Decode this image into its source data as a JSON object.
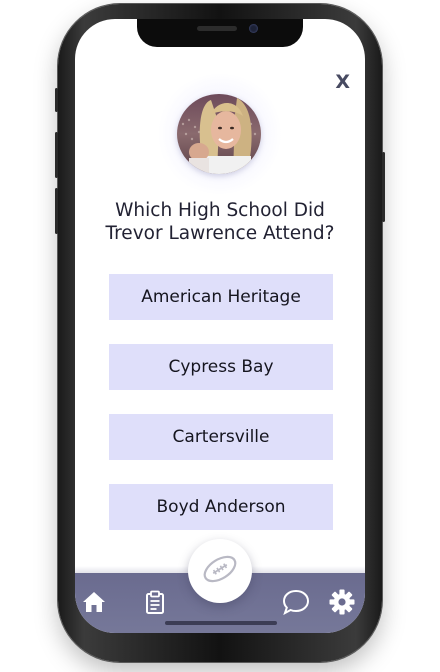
{
  "quiz": {
    "close_label": "X",
    "question": "Which High School Did Trevor Lawrence Attend?",
    "answers": [
      "American Heritage",
      "Cypress Bay",
      "Cartersville",
      "Boyd Anderson"
    ]
  },
  "bottom_nav": {
    "items": [
      "home-icon",
      "clipboard-icon",
      "football-icon",
      "chat-icon",
      "gear-icon"
    ]
  },
  "colors": {
    "answer_bg": "#dfdffa",
    "nav_bg": "#6a6b8f",
    "close": "#474a61"
  }
}
